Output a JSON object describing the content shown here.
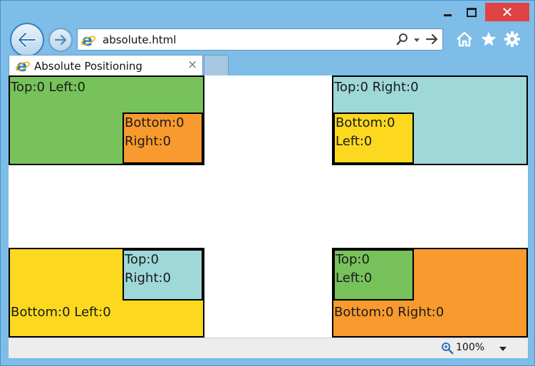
{
  "window": {
    "close_glyph": "✕"
  },
  "address_bar": {
    "url": "absolute.html"
  },
  "tab": {
    "title": "Absolute Positioning",
    "close_glyph": "×"
  },
  "content": {
    "top_left": {
      "label": "Top:0 Left:0",
      "inner_line1": "Bottom:0",
      "inner_line2": "Right:0"
    },
    "top_right": {
      "label": "Top:0 Right:0",
      "inner_line1": "Bottom:0",
      "inner_line2": "Left:0"
    },
    "bottom_left": {
      "label": "Bottom:0 Left:0",
      "inner_line1": "Top:0",
      "inner_line2": "Right:0"
    },
    "bottom_right": {
      "label": "Bottom:0 Right:0",
      "inner_line1": "Top:0",
      "inner_line2": "Left:0"
    }
  },
  "status_bar": {
    "zoom": "100%"
  },
  "colors": {
    "green": "#77c25a",
    "orange": "#f89a2e",
    "teal": "#9ed8d8",
    "yellow": "#fcd91f",
    "close": "#e04343"
  },
  "icons": [
    "back-arrow-icon",
    "forward-arrow-icon",
    "ie-logo-icon",
    "search-icon",
    "chevron-down-icon",
    "go-arrow-icon",
    "home-icon",
    "star-icon",
    "gear-icon",
    "zoom-icon"
  ]
}
